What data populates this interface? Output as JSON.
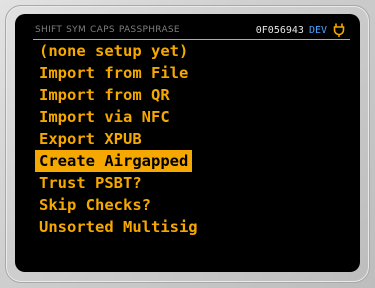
{
  "statusbar": {
    "flags": [
      "SHIFT",
      "SYM",
      "CAPS",
      "PASSPHRASE"
    ],
    "fingerprint": "0F056943",
    "mode": "DEV",
    "icon": "plug-icon"
  },
  "menu": {
    "items": [
      "(none setup yet)",
      "Import from File",
      "Import from QR",
      "Import via NFC",
      "Export XPUB",
      "Create Airgapped",
      "Trust PSBT?",
      "Skip Checks?",
      "Unsorted Multisig"
    ],
    "selected": "Create Airgapped"
  },
  "colors": {
    "accent": "#f5a800",
    "background": "#000000",
    "bezel": "#cfcfcf",
    "dev": "#4aa3ff"
  }
}
